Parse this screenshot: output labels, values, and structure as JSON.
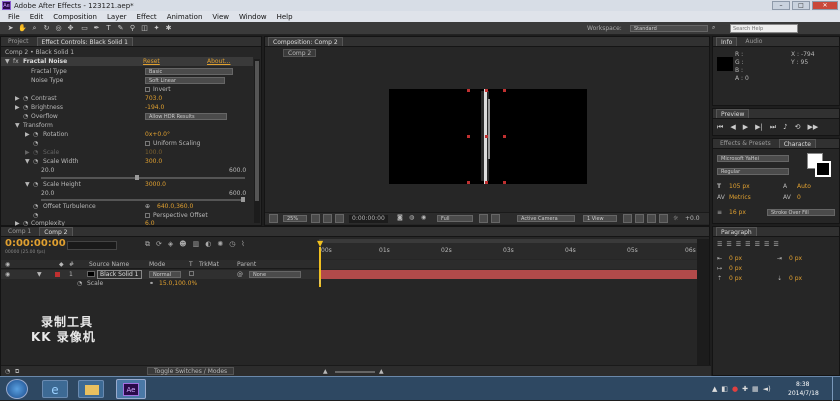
{
  "window": {
    "title": "Adobe After Effects - 123121.aep*",
    "app_icon": "Ae",
    "minimize": "–",
    "maximize": "□",
    "close": "✕"
  },
  "menu": [
    "File",
    "Edit",
    "Composition",
    "Layer",
    "Effect",
    "Animation",
    "View",
    "Window",
    "Help"
  ],
  "toolbar": {
    "workspace_label": "Workspace:",
    "workspace_value": "Standard",
    "search_placeholder": "Search Help"
  },
  "left_panel": {
    "tabs": [
      "Project",
      "Effect Controls: Black Solid 1"
    ],
    "breadcrumb": "Comp 2 • Black Solid 1",
    "effect": {
      "name": "Fractal Noise",
      "reset": "Reset",
      "about": "About...",
      "rows": [
        {
          "label": "Fractal Type",
          "value": "Basic"
        },
        {
          "label": "Noise Type",
          "value": "Soft Linear"
        },
        {
          "label": "",
          "value": "Invert"
        },
        {
          "label": "Contrast",
          "value": "703.0"
        },
        {
          "label": "Brightness",
          "value": "-194.0"
        },
        {
          "label": "Overflow",
          "value": "Allow HDR Results"
        },
        {
          "label": "Transform",
          "value": ""
        },
        {
          "label": "Rotation",
          "value": "0x+0.0°"
        },
        {
          "label": "",
          "value": "Uniform Scaling"
        },
        {
          "label": "Scale",
          "value": "100.0"
        },
        {
          "label": "Scale Width",
          "value": "300.0"
        },
        {
          "label": "Scale Height",
          "value": "3000.0"
        },
        {
          "label": "Offset Turbulence",
          "value": "640.0,360.0"
        },
        {
          "label": "",
          "value": "Perspective Offset"
        },
        {
          "label": "Complexity",
          "value": "6.0"
        }
      ],
      "slider_min": "20.0",
      "slider_max": "600.0"
    }
  },
  "viewer": {
    "tab": "Composition: Comp 2",
    "subtab": "Comp 2",
    "zoom": "25%",
    "timecode": "0:00:00:00",
    "resolution": "Full",
    "camera": "Active Camera",
    "views": "1 View",
    "exposure": "+0.0"
  },
  "right_panel": {
    "info_tabs": [
      "Info",
      "Audio"
    ],
    "info": {
      "r": "R :",
      "g": "G :",
      "b": "B :",
      "a": "A : 0",
      "x": "X : -794",
      "y": "Y : 95"
    },
    "preview_tab": "Preview",
    "char_tabs": [
      "Effects & Presets",
      "Characte"
    ],
    "font_name": "Microsoft YaHei",
    "font_style": "Regular",
    "font_size": "105 px",
    "leading": "Auto",
    "kerning": "Metrics",
    "tracking": "0",
    "stroke_size": "16 px",
    "stroke_mode": "Stroke Over Fill",
    "paragraph_tab": "Paragraph",
    "indent_values": [
      "0 px",
      "0 px",
      "0 px",
      "0 px",
      "0 px"
    ]
  },
  "timeline": {
    "tabs": [
      "Comp 1",
      "Comp 2"
    ],
    "timecode": "0:00:00:00",
    "frame_info": "00000 (25.00 fps)",
    "columns": {
      "source": "Source Name",
      "mode": "Mode",
      "t": "T",
      "trkmat": "TrkMat",
      "parent": "Parent"
    },
    "layer": {
      "index": "1",
      "name": "Black Solid 1",
      "mode": "Normal",
      "parent": "None"
    },
    "property": {
      "name": "Scale",
      "value": "15.0,100.0%"
    },
    "ruler": [
      "00s",
      "01s",
      "02s",
      "03s",
      "04s",
      "05s",
      "06s"
    ],
    "toggle_label": "Toggle Switches / Modes"
  },
  "watermark": {
    "line1": "录制工具",
    "line2": "KK 录像机"
  },
  "taskbar": {
    "time": "8:38",
    "date": "2014/7/18",
    "app": "Ae"
  }
}
